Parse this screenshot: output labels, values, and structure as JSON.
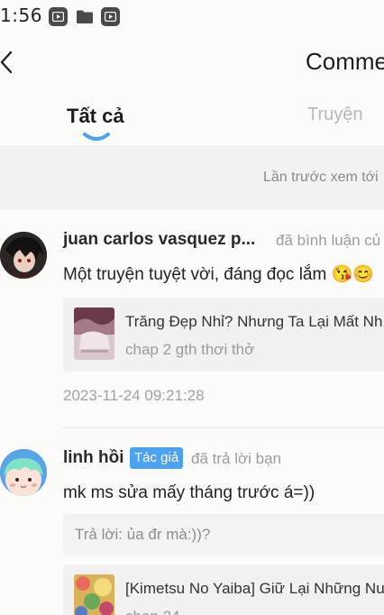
{
  "status_bar": {
    "time": "1:56"
  },
  "header": {
    "title": "Comme"
  },
  "tabs": [
    {
      "label": "Tất cả",
      "active": true
    },
    {
      "label": "Truyện",
      "active": false
    }
  ],
  "notice": {
    "text": "Lần trước xem tới"
  },
  "comments": [
    {
      "username": "juan carlos vasquez p...",
      "action": "đã bình luận củ",
      "text": "Một truyện tuyệt vời, đáng đọc lắm 😘😊",
      "story": {
        "title": "Trăng Đẹp Nhỉ? Nhưng Ta Lại Mất Nh",
        "chapter": "chap 2 gth thơi thở"
      },
      "timestamp": "2023-11-24 09:21:28"
    },
    {
      "username": "linh hồi",
      "badge": "Tác giả",
      "action": "đã trả lời bạn",
      "text": "mk ms sửa mấy tháng trước á=))",
      "reply_quote": "Trả lời: ủa đr mà:))?",
      "story": {
        "title": "[Kimetsu No Yaiba] Giữ Lại Những Nu",
        "chapter": "chap 24"
      }
    }
  ],
  "colors": {
    "accent": "#4aa2f0",
    "muted": "#9b9b9b",
    "card_bg": "#f1f1f1"
  }
}
